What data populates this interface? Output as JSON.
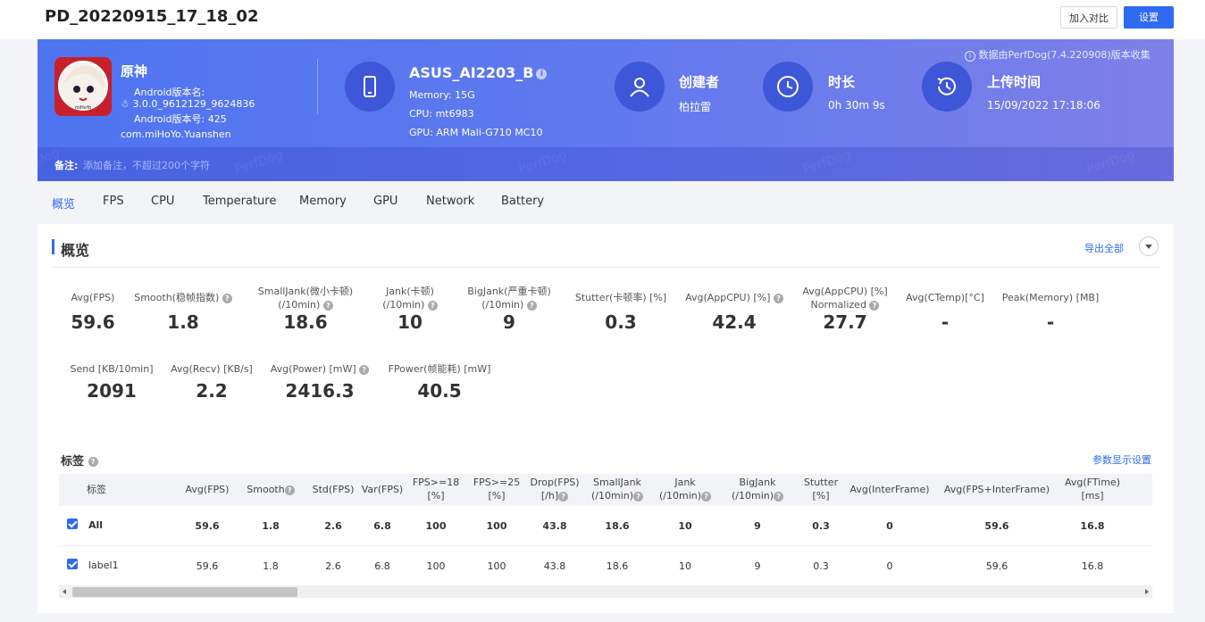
{
  "header": {
    "title": "PD_20220915_17_18_02",
    "compare_label": "加入对比",
    "settings_label": "设置"
  },
  "banner": {
    "source_text": "数据由PerfDog(7.4.220908)版本收集",
    "app": {
      "name": "原神",
      "android_version_name_label": "Android版本名:",
      "android_version_name": "3.0.0_9612129_9624836",
      "android_version_code": "Android版本号: 425",
      "package": "com.miHoYo.Yuanshen",
      "icon_text": "miHoYo"
    },
    "device": {
      "name": "ASUS_AI2203_B",
      "memory": "Memory: 15G",
      "cpu": "CPU: mt6983",
      "gpu": "GPU: ARM Mali-G710 MC10"
    },
    "creator": {
      "title": "创建者",
      "value": "柏拉雷"
    },
    "duration": {
      "title": "时长",
      "value": "0h 30m 9s"
    },
    "upload": {
      "title": "上传时间",
      "value": "15/09/2022 17:18:06"
    },
    "note_label": "备注:",
    "note_placeholder": "添加备注，不超过200个字符",
    "watermark": "PerfDog"
  },
  "tabs": [
    "概览",
    "FPS",
    "CPU",
    "Temperature",
    "Memory",
    "GPU",
    "Network",
    "Battery"
  ],
  "overview": {
    "title": "概览",
    "export_label": "导出全部",
    "metrics_row1": [
      {
        "label": "Avg(FPS)",
        "value": "59.6"
      },
      {
        "label": "Smooth(稳帧指数)",
        "value": "1.8"
      },
      {
        "label": "SmallJank(微小卡顿)",
        "label2": "(/10min)",
        "value": "18.6"
      },
      {
        "label": "Jank(卡顿)",
        "label2": "(/10min)",
        "value": "10"
      },
      {
        "label": "BigJank(严重卡顿)",
        "label2": "(/10min)",
        "value": "9"
      },
      {
        "label": "Stutter(卡顿率) [%]",
        "value": "0.3"
      },
      {
        "label": "Avg(AppCPU) [%]",
        "value": "42.4"
      },
      {
        "label": "Avg(AppCPU) [%]",
        "label2": "Normalized",
        "value": "27.7"
      },
      {
        "label": "Avg(CTemp)[°C]",
        "value": "-"
      },
      {
        "label": "Peak(Memory) [MB]",
        "value": "-"
      }
    ],
    "metrics_row2": [
      {
        "label": "Send [KB/10min]",
        "value": "2091"
      },
      {
        "label": "Avg(Recv) [KB/s]",
        "value": "2.2"
      },
      {
        "label": "Avg(Power) [mW]",
        "value": "2416.3"
      },
      {
        "label": "FPower(帧能耗) [mW]",
        "value": "40.5"
      }
    ]
  },
  "tags": {
    "title": "标签",
    "param_settings": "参数显示设置",
    "columns": [
      {
        "l1": "标签",
        "l2": ""
      },
      {
        "l1": "Avg(FPS)",
        "l2": ""
      },
      {
        "l1": "Smooth",
        "l2": ""
      },
      {
        "l1": "Std(FPS)",
        "l2": ""
      },
      {
        "l1": "Var(FPS)",
        "l2": ""
      },
      {
        "l1": "FPS>=18",
        "l2": "[%]"
      },
      {
        "l1": "FPS>=25",
        "l2": "[%]"
      },
      {
        "l1": "Drop(FPS)",
        "l2": "[/h]"
      },
      {
        "l1": "SmallJank",
        "l2": "(/10min)"
      },
      {
        "l1": "Jank",
        "l2": "(/10min)"
      },
      {
        "l1": "BigJank",
        "l2": "(/10min)"
      },
      {
        "l1": "Stutter",
        "l2": "[%]"
      },
      {
        "l1": "Avg(InterFrame)",
        "l2": ""
      },
      {
        "l1": "Avg(FPS+InterFrame)",
        "l2": ""
      },
      {
        "l1": "Avg(FTime)",
        "l2": "[ms]"
      }
    ],
    "rows": [
      {
        "name": "All",
        "cells": [
          "59.6",
          "1.8",
          "2.6",
          "6.8",
          "100",
          "100",
          "43.8",
          "18.6",
          "10",
          "9",
          "0.3",
          "0",
          "59.6",
          "16.8"
        ]
      },
      {
        "name": "label1",
        "cells": [
          "59.6",
          "1.8",
          "2.6",
          "6.8",
          "100",
          "100",
          "43.8",
          "18.6",
          "10",
          "9",
          "0.3",
          "0",
          "59.6",
          "16.8"
        ]
      }
    ]
  }
}
